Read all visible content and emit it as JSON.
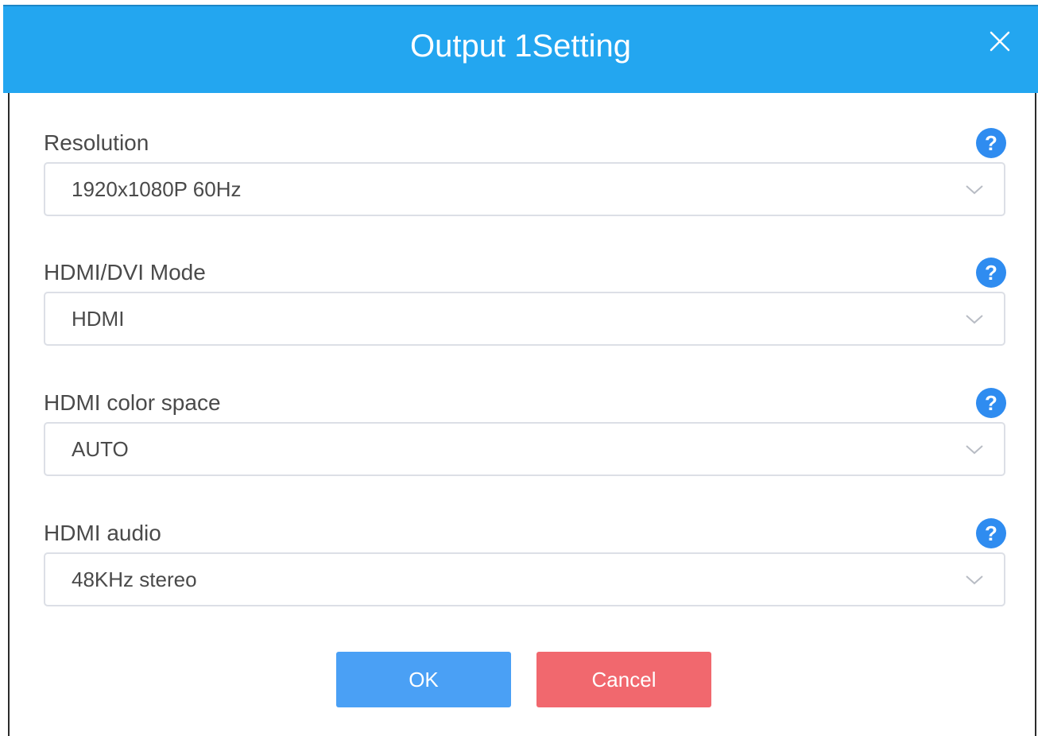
{
  "dialog": {
    "title": "Output 1Setting",
    "close_icon": "close-icon"
  },
  "fields": [
    {
      "label": "Resolution",
      "value": "1920x1080P 60Hz"
    },
    {
      "label": "HDMI/DVI Mode",
      "value": "HDMI"
    },
    {
      "label": "HDMI color space",
      "value": "AUTO"
    },
    {
      "label": "HDMI audio",
      "value": "48KHz stereo"
    }
  ],
  "buttons": {
    "ok_label": "OK",
    "cancel_label": "Cancel"
  },
  "colors": {
    "header": "#23a6f0",
    "help_icon": "#2f8cf0",
    "ok_button": "#4aa0f5",
    "cancel_button": "#f1686e"
  }
}
